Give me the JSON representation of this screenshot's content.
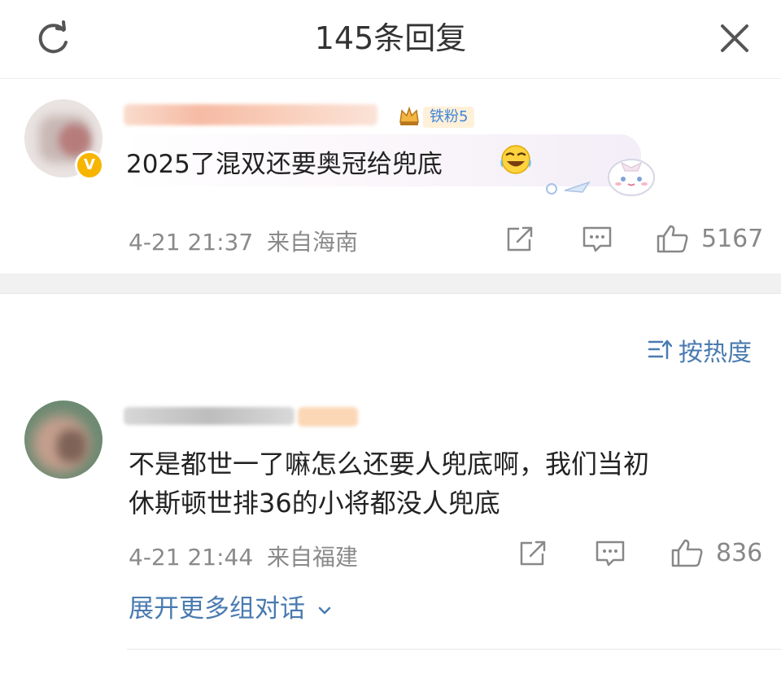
{
  "header": {
    "title": "145条回复",
    "refresh_icon": "refresh-icon",
    "close_icon": "close-icon"
  },
  "main_comment": {
    "badge_label": "铁粉5",
    "text": "2025了混双还要奥冠给兜底",
    "emoji": "laugh-cry-emoji",
    "verified_icon": "verified-v-icon",
    "timestamp": "4-21 21:37",
    "location": "来自海南",
    "likes": "5167",
    "icons": [
      "share-icon",
      "comment-icon",
      "like-icon"
    ]
  },
  "sort": {
    "label": "按热度",
    "icon": "sort-icon"
  },
  "reply": {
    "text_line1": "不是都世一了嘛怎么还要人兜底啊，我们当初",
    "text_line2": "休斯顿世排36的小将都没人兜底",
    "timestamp": "4-21 21:44",
    "location": "来自福建",
    "likes": "836",
    "expand_label": "展开更多组对话",
    "icons": [
      "share-icon",
      "comment-icon",
      "like-icon",
      "chevron-down-icon"
    ]
  },
  "colors": {
    "link_blue": "#4a7bb0",
    "meta_gray": "#8a8a8a",
    "verified_gold": "#f7b500",
    "fan_badge_bg": "#fff0d9",
    "fan_badge_text": "#3e86d8"
  }
}
